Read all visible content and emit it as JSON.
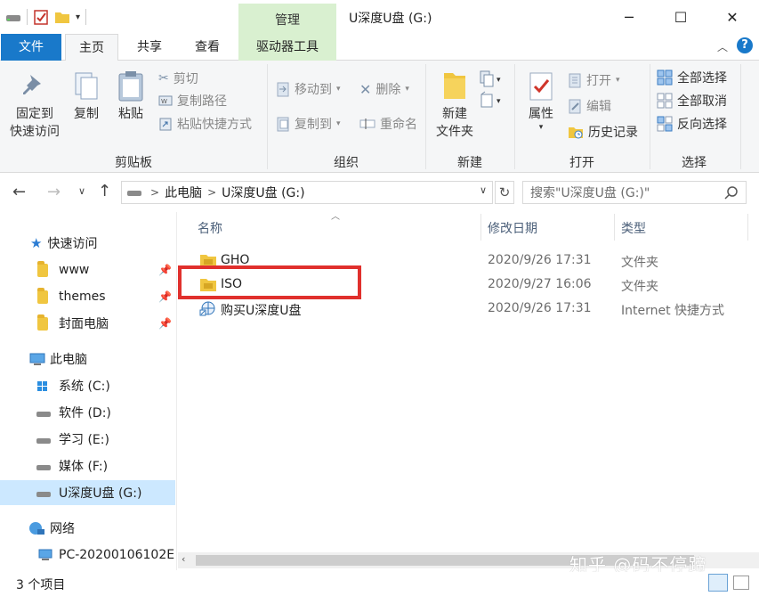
{
  "window": {
    "manage_label": "管理",
    "title": "U深度U盘 (G:)",
    "minimize": "─",
    "maximize": "☐",
    "close": "✕"
  },
  "tabs": {
    "file": "文件",
    "home": "主页",
    "share": "共享",
    "view": "查看",
    "drive_tools": "驱动器工具"
  },
  "ribbon": {
    "clipboard": {
      "label": "剪贴板",
      "pin": "固定到\n快速访问",
      "pin_l1": "固定到",
      "pin_l2": "快速访问",
      "copy": "复制",
      "paste": "粘贴",
      "cut": "剪切",
      "copy_path": "复制路径",
      "paste_shortcut": "粘贴快捷方式"
    },
    "organize": {
      "label": "组织",
      "move_to": "移动到",
      "copy_to": "复制到",
      "delete": "删除",
      "rename": "重命名"
    },
    "new": {
      "label": "新建",
      "new_folder_l1": "新建",
      "new_folder_l2": "文件夹"
    },
    "open": {
      "label": "打开",
      "properties": "属性",
      "open": "打开",
      "edit": "编辑",
      "history": "历史记录"
    },
    "select": {
      "label": "选择",
      "select_all": "全部选择",
      "select_none": "全部取消",
      "invert": "反向选择"
    }
  },
  "address": {
    "path_root": "此电脑",
    "path_sep": ">",
    "path_drive": "U深度U盘 (G:)",
    "search_placeholder": "搜索\"U深度U盘 (G:)\""
  },
  "nav_pane": {
    "quick_access": "快速访问",
    "pinned": [
      "www",
      "themes",
      "封面电脑"
    ],
    "this_pc": "此电脑",
    "drives": [
      "系统 (C:)",
      "软件 (D:)",
      "学习 (E:)",
      "媒体 (F:)",
      "U深度U盘 (G:)"
    ],
    "network": "网络",
    "network_pc": "PC-20200106102E"
  },
  "columns": {
    "name": "名称",
    "modified": "修改日期",
    "type": "类型"
  },
  "files": [
    {
      "name": "GHO",
      "modified": "2020/9/26 17:31",
      "type": "文件夹"
    },
    {
      "name": "ISO",
      "modified": "2020/9/27 16:06",
      "type": "文件夹"
    },
    {
      "name": "购买U深度U盘",
      "modified": "2020/9/26 17:31",
      "type": "Internet 快捷方式"
    }
  ],
  "status": {
    "count": "3 个项目"
  },
  "watermark": "知乎 @码不停蹄",
  "colors": {
    "accent": "#1979ca",
    "manage_green": "#d9f0d0",
    "highlight_red": "#e0302d",
    "selection": "#cce8ff"
  }
}
